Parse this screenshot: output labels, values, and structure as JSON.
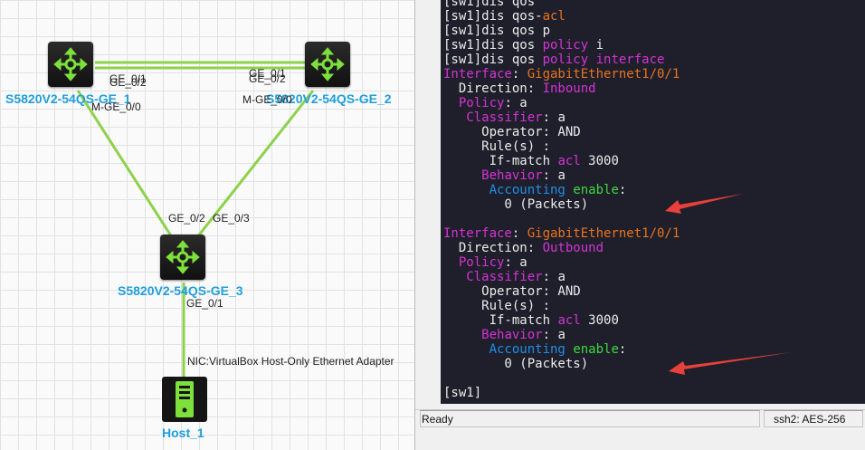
{
  "topology": {
    "devices": [
      {
        "label": "S5820V2-54QS-GE_1",
        "icon": "router-icon"
      },
      {
        "label": "S5820V2-54QS-GE_2",
        "icon": "router-icon"
      },
      {
        "label": "S5820V2-54QS-GE_3",
        "icon": "router-icon"
      },
      {
        "label": "Host_1",
        "icon": "host-icon"
      }
    ],
    "ports": {
      "sw1_a": "GE_0/1",
      "sw1_b": "GE_0/2",
      "sw1_mgmt": "M-GE_0/0",
      "sw2_a": "GE_0/1",
      "sw2_b": "GE_0/2",
      "sw2_mgmt": "M-GE_0/0",
      "sw3_a": "GE_0/2",
      "sw3_b": "GE_0/3",
      "sw3_down": "GE_0/1",
      "host_nic": "NIC:VirtualBox Host-Only Ethernet Adapter"
    },
    "colors": {
      "link": "#8ed14a",
      "label": "#1e9fdc",
      "device": "#7ee03a"
    }
  },
  "terminal": {
    "lines": [
      [
        {
          "t": "[sw1]dis qos"
        }
      ],
      [
        {
          "t": "[sw1]dis qos-"
        },
        {
          "t": "acl",
          "c": "c-org"
        }
      ],
      [
        {
          "t": "[sw1]dis qos p"
        }
      ],
      [
        {
          "t": "[sw1]dis qos "
        },
        {
          "t": "policy",
          "c": "c-mag"
        },
        {
          "t": " i"
        }
      ],
      [
        {
          "t": "[sw1]dis qos "
        },
        {
          "t": "policy",
          "c": "c-mag"
        },
        {
          "t": " "
        },
        {
          "t": "interface",
          "c": "c-mag"
        }
      ],
      [
        {
          "t": "Interface",
          "c": "c-mag"
        },
        {
          "t": ": "
        },
        {
          "t": "GigabitEthernet1/0/1",
          "c": "c-org"
        }
      ],
      [
        {
          "t": "  Direction: "
        },
        {
          "t": "Inbound",
          "c": "c-mag"
        }
      ],
      [
        {
          "t": "  "
        },
        {
          "t": "Policy",
          "c": "c-mag"
        },
        {
          "t": ": a"
        }
      ],
      [
        {
          "t": "   "
        },
        {
          "t": "Classifier",
          "c": "c-mag"
        },
        {
          "t": ": a"
        }
      ],
      [
        {
          "t": "     Operator: AND"
        }
      ],
      [
        {
          "t": "     Rule(s) :"
        }
      ],
      [
        {
          "t": "      If-match "
        },
        {
          "t": "acl",
          "c": "c-mag"
        },
        {
          "t": " 3000"
        }
      ],
      [
        {
          "t": "     "
        },
        {
          "t": "Behavior",
          "c": "c-mag"
        },
        {
          "t": ": a"
        }
      ],
      [
        {
          "t": "      "
        },
        {
          "t": "Accounting",
          "c": "c-cyan"
        },
        {
          "t": " "
        },
        {
          "t": "enable",
          "c": "c-grn"
        },
        {
          "t": ":"
        }
      ],
      [
        {
          "t": "        0 (Packets)"
        }
      ],
      [
        {
          "t": ""
        }
      ],
      [
        {
          "t": "Interface",
          "c": "c-mag"
        },
        {
          "t": ": "
        },
        {
          "t": "GigabitEthernet1/0/1",
          "c": "c-org"
        }
      ],
      [
        {
          "t": "  Direction: "
        },
        {
          "t": "Outbound",
          "c": "c-mag"
        }
      ],
      [
        {
          "t": "  "
        },
        {
          "t": "Policy",
          "c": "c-mag"
        },
        {
          "t": ": a"
        }
      ],
      [
        {
          "t": "   "
        },
        {
          "t": "Classifier",
          "c": "c-mag"
        },
        {
          "t": ": a"
        }
      ],
      [
        {
          "t": "     Operator: AND"
        }
      ],
      [
        {
          "t": "     Rule(s) :"
        }
      ],
      [
        {
          "t": "      If-match "
        },
        {
          "t": "acl",
          "c": "c-mag"
        },
        {
          "t": " 3000"
        }
      ],
      [
        {
          "t": "     "
        },
        {
          "t": "Behavior",
          "c": "c-mag"
        },
        {
          "t": ": a"
        }
      ],
      [
        {
          "t": "      "
        },
        {
          "t": "Accounting",
          "c": "c-cyan"
        },
        {
          "t": " "
        },
        {
          "t": "enable",
          "c": "c-grn"
        },
        {
          "t": ":"
        }
      ],
      [
        {
          "t": "        0 (Packets)"
        }
      ],
      [
        {
          "t": ""
        }
      ],
      [
        {
          "t": "[sw1]"
        }
      ]
    ],
    "colors": {
      "background": "#1f1f2b",
      "text": "#ececec",
      "annotation_arrow": "#e8403a"
    }
  },
  "status_bar": {
    "left": "Ready",
    "right": "ssh2: AES-256"
  }
}
